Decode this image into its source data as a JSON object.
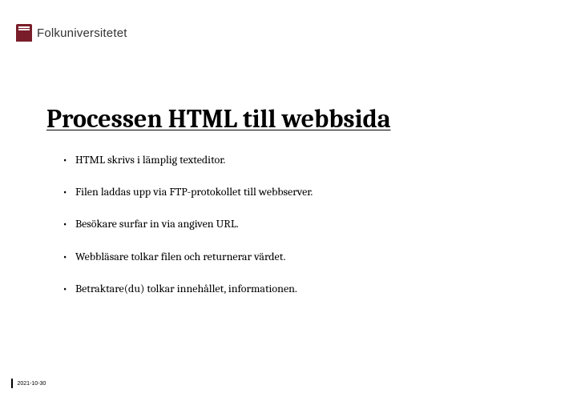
{
  "logo": {
    "brand_text": "Folkuniversitetet"
  },
  "heading": "Processen HTML till webbsida",
  "bullets": [
    "HTML skrivs i lämplig texteditor.",
    "Filen laddas upp via FTP-protokollet till webbserver.",
    "Besökare surfar in via angiven URL.",
    "Webbläsare tolkar filen och returnerar värdet.",
    "Betraktare(du) tolkar innehållet, informationen."
  ],
  "footer": {
    "date": "2021-10-30"
  }
}
